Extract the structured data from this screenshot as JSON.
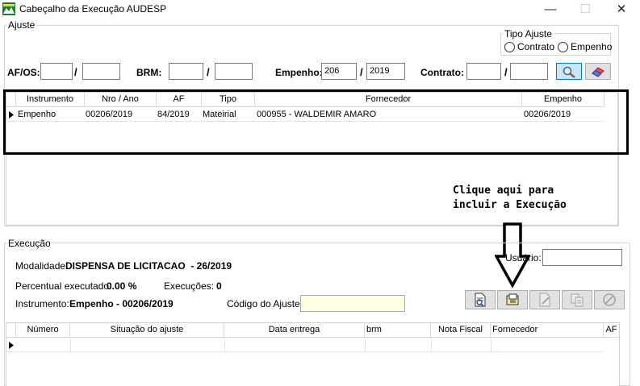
{
  "window": {
    "title": "Cabeçalho da Execução AUDESP",
    "app_icon": "audesp-logo-icon",
    "controls": [
      "minimize-icon",
      "maximize-icon",
      "close-icon"
    ]
  },
  "ajuste": {
    "group_label": "Ajuste",
    "tipo_ajuste": {
      "label": "Tipo Ajuste",
      "options": [
        "Contrato",
        "Empenho"
      ],
      "selected": null
    },
    "af_os": {
      "label": "AF/OS:",
      "value1": "",
      "value2": "",
      "separator": "/"
    },
    "brm": {
      "label": "BRM:",
      "value1": "",
      "value2": "",
      "separator": "/"
    },
    "empenho": {
      "label": "Empenho:",
      "value1": "206",
      "value2": "2019",
      "separator": "/"
    },
    "contrato": {
      "label": "Contrato:",
      "value1": "",
      "value2": "",
      "separator": "/"
    },
    "search_button_icon": "search-icon",
    "clear_button_icon": "eraser-icon",
    "table": {
      "columns": [
        "Instrumento",
        "Nro / Ano",
        "AF",
        "Tipo",
        "Fornecedor",
        "Empenho"
      ],
      "rows": [
        [
          "Empenho",
          "00206/2019",
          "84/2019",
          "Mateirial",
          "000955 - WALDEMIR AMARO",
          "00206/2019"
        ]
      ]
    }
  },
  "annotation": {
    "line1": "Clique aqui para",
    "line2": "incluir a Execução"
  },
  "execucao": {
    "group_label": "Execução",
    "modalidade": {
      "label": "Modalidade:",
      "value": "DISPENSA DE LICITACAO  - 26/2019"
    },
    "percentual": {
      "label": "Percentual executado:",
      "value": "0.00 %"
    },
    "execucoes": {
      "label": "Execuções:",
      "value": "0"
    },
    "instrumento": {
      "label": "Instrumento:",
      "value": "Empenho - 00206/2019"
    },
    "codigo_ajuste": {
      "label": "Código do Ajuste:",
      "value": ""
    },
    "usuario": {
      "label": "Usuário:",
      "value": ""
    },
    "toolbar_icons": [
      "view-document-icon",
      "add-document-icon",
      "edit-document-icon",
      "copy-document-icon",
      "cancel-icon"
    ],
    "table": {
      "columns": [
        "Número",
        "Situação do ajuste",
        "Data entrega",
        "brm",
        "Nota Fiscal",
        "Fornecedor",
        "AF"
      ],
      "rows": []
    }
  },
  "colors": {
    "highlight_border": "#000000",
    "yellow_field": "#ffffe1",
    "button_face": "#e1e1e1",
    "selected_button": "#cce4f7"
  }
}
